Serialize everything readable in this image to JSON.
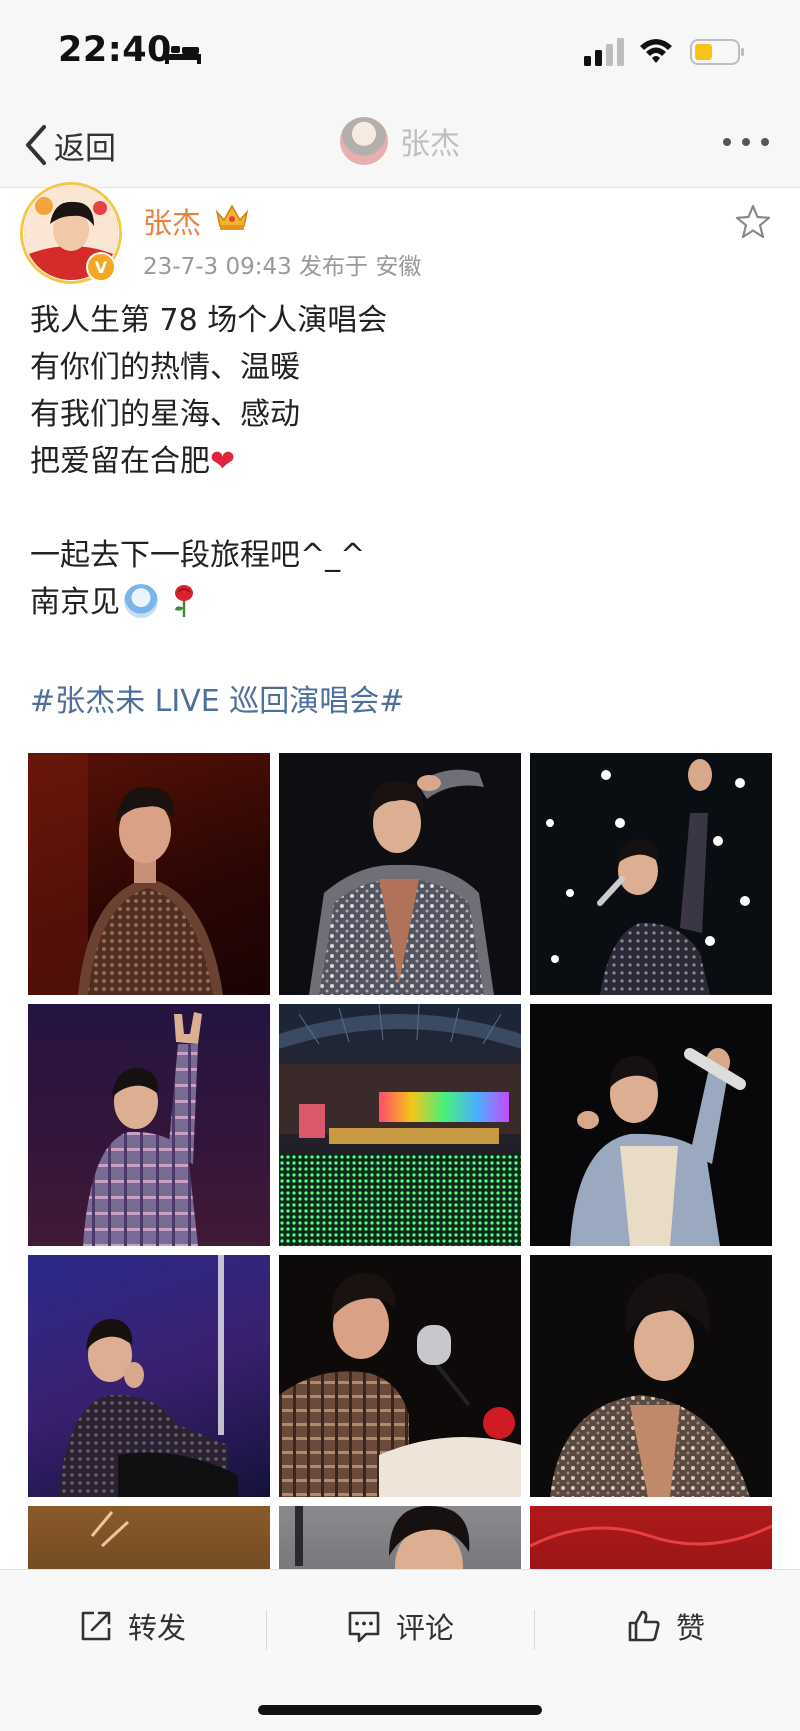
{
  "status_bar": {
    "time": "22:40",
    "icons": [
      "bed-icon",
      "signal-icon",
      "wifi-icon",
      "battery-icon"
    ],
    "battery_color": "#f5c518"
  },
  "nav": {
    "back_label": "返回",
    "title": "张杰",
    "more_icon": "more-icon"
  },
  "post": {
    "author": "张杰",
    "meta": "23-7-3 09:43  发布于 安徽",
    "author_color": "#e8823a",
    "verified_badge": "V",
    "lines": [
      "我人生第 78 场个人演唱会",
      "有你们的热情、温暖",
      "有我们的星海、感动",
      "把爱留在合肥",
      "",
      "一起去下一段旅程吧^_^",
      "南京见"
    ],
    "heart": "❤",
    "hashtag": "#张杰未 LIVE 巡回演唱会#",
    "hashtag_color": "#4c6f9c"
  },
  "photos": [
    {
      "name": "photo-knit-top"
    },
    {
      "name": "photo-sequin-jacket-salute"
    },
    {
      "name": "photo-singing-lights"
    },
    {
      "name": "photo-rock-hand"
    },
    {
      "name": "photo-stadium-crowd"
    },
    {
      "name": "photo-mic-raised"
    },
    {
      "name": "photo-seated-purple"
    },
    {
      "name": "photo-piano-mic"
    },
    {
      "name": "photo-sequin-smile"
    },
    {
      "name": "photo-partial-1"
    },
    {
      "name": "photo-partial-2"
    },
    {
      "name": "photo-partial-3"
    }
  ],
  "actions": {
    "repost": "转发",
    "comment": "评论",
    "like": "赞"
  }
}
